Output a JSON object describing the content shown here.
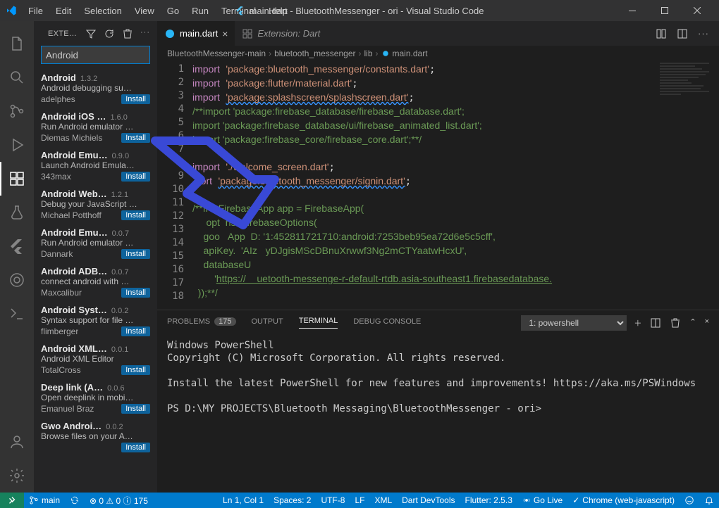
{
  "title": "main.dart - BluetoothMessenger - ori - Visual Studio Code",
  "menu": [
    "File",
    "Edit",
    "Selection",
    "View",
    "Go",
    "Run",
    "Terminal",
    "Help"
  ],
  "sidebar": {
    "heading": "EXTE…",
    "search_value": "Android",
    "items": [
      {
        "name": "Android",
        "ver": "1.3.2",
        "desc": "Android debugging su…",
        "pub": "adelphes"
      },
      {
        "name": "Android iOS …",
        "ver": "1.6.0",
        "desc": "Run Android emulator …",
        "pub": "Diemas Michiels"
      },
      {
        "name": "Android Emu…",
        "ver": "0.9.0",
        "desc": "Launch Android Emula…",
        "pub": "343max"
      },
      {
        "name": "Android Web…",
        "ver": "1.2.1",
        "desc": "Debug your JavaScript …",
        "pub": "Michael Potthoff"
      },
      {
        "name": "Android Emu…",
        "ver": "0.0.7",
        "desc": "Run Android emulator …",
        "pub": "Dannark"
      },
      {
        "name": "Android ADB…",
        "ver": "0.0.7",
        "desc": "connect android with …",
        "pub": "Maxcalibur"
      },
      {
        "name": "Android Syst…",
        "ver": "0.0.2",
        "desc": "Syntax support for file …",
        "pub": "flimberger"
      },
      {
        "name": "Android XML…",
        "ver": "0.0.1",
        "desc": "Android XML Editor",
        "pub": "TotalCross"
      },
      {
        "name": "Deep link (A…",
        "ver": "0.0.6",
        "desc": "Open deeplink in mobi…",
        "pub": "Emanuel Braz"
      },
      {
        "name": "Gwo Androi…",
        "ver": "0.0.2",
        "desc": "Browse files on your A…",
        "pub": ""
      }
    ],
    "install_label": "Install"
  },
  "tabs": [
    {
      "label": "main.dart",
      "active": true,
      "icon": "dart"
    },
    {
      "label": "Extension: Dart",
      "active": false,
      "icon": "ext"
    }
  ],
  "breadcrumb": [
    "BluetoothMessenger-main",
    "bluetooth_messenger",
    "lib",
    "main.dart"
  ],
  "code": {
    "lines": [
      {
        "n": 1,
        "html": "<span class='kw'>import</span> <span class='str'>'package:bluetooth_messenger/constants.dart'</span>;"
      },
      {
        "n": 2,
        "html": "<span class='kw'>import</span> <span class='str'>'package:flutter/material.dart'</span>;"
      },
      {
        "n": 3,
        "html": "<span class='kw'>import</span> <span class='str wavy'>'package:splashscreen/splashscreen.dart'</span>;"
      },
      {
        "n": 4,
        "html": "<span class='cmt'>/**import 'package:firebase_database/firebase_database.dart';</span>"
      },
      {
        "n": 5,
        "html": "<span class='cmt'>import 'package:firebase_database/ui/firebase_animated_list.dart';</span>"
      },
      {
        "n": 6,
        "html": "<span class='cmt'>import 'package:firebase_core/firebase_core.dart';**/</span>"
      },
      {
        "n": 7,
        "html": ""
      },
      {
        "n": 8,
        "html": "<span class='kw'>import</span> <span class='str'>'./welcome_screen.dart'</span>;"
      },
      {
        "n": 9,
        "html": "<span class='kw'>   ort</span> <span class='str wavy'>'package:bluetooth_messenger/signin.dart'</span>;"
      },
      {
        "n": 10,
        "html": ""
      },
      {
        "n": 11,
        "html": "<span class='cmt'>/**fi  l FirebaseApp app = FirebaseApp(</span>"
      },
      {
        "n": 12,
        "html": "<span class='cmt'>     opt  ns: FirebaseOptions(</span>"
      },
      {
        "n": 13,
        "html": "<span class='cmt'>    goo   App  D: '1:452811721710:android:7253beb95ea72d6e5c5cff',</span>"
      },
      {
        "n": 14,
        "html": "<span class='cmt'>    apiKey.  'AIz   yDJgisMScDBnuXrwwf3Ng2mCTYaatwHcxU',</span>"
      },
      {
        "n": 15,
        "html": "<span class='cmt'>    databaseU</span>"
      },
      {
        "n": 16,
        "html": "<span class='cmt'>        '<u>https://    uetooth-messenge-r-default-rtdb.asia-southeast1.firebasedatabase.</u></span>"
      },
      {
        "n": 17,
        "html": "<span class='cmt'>  ));**/</span>"
      },
      {
        "n": 18,
        "html": ""
      }
    ]
  },
  "panel": {
    "tabs": [
      {
        "label": "PROBLEMS",
        "badge": "175"
      },
      {
        "label": "OUTPUT"
      },
      {
        "label": "TERMINAL",
        "active": true
      },
      {
        "label": "DEBUG CONSOLE"
      }
    ],
    "term_selected": "1: powershell",
    "terminal_lines": [
      "Windows PowerShell",
      "Copyright (C) Microsoft Corporation. All rights reserved.",
      "",
      "Install the latest PowerShell for new features and improvements! https://aka.ms/PSWindows",
      "",
      "PS D:\\MY PROJECTS\\Bluetooth Messaging\\BluetoothMessenger - ori>"
    ]
  },
  "statusbar": {
    "left": [
      {
        "icon": "branch",
        "text": "main"
      },
      {
        "icon": "sync",
        "text": ""
      },
      {
        "icon": "",
        "text": "⊗ 0 ⚠ 0 ⓘ 175"
      }
    ],
    "right": [
      {
        "text": "Ln 1, Col 1"
      },
      {
        "text": "Spaces: 2"
      },
      {
        "text": "UTF-8"
      },
      {
        "text": "LF"
      },
      {
        "text": "XML"
      },
      {
        "text": "Dart DevTools"
      },
      {
        "text": "Flutter: 2.5.3"
      },
      {
        "icon": "broadcast",
        "text": "Go Live"
      },
      {
        "icon": "check",
        "text": "Chrome (web-javascript)"
      },
      {
        "icon": "feedback",
        "text": ""
      },
      {
        "icon": "bell",
        "text": ""
      }
    ]
  }
}
